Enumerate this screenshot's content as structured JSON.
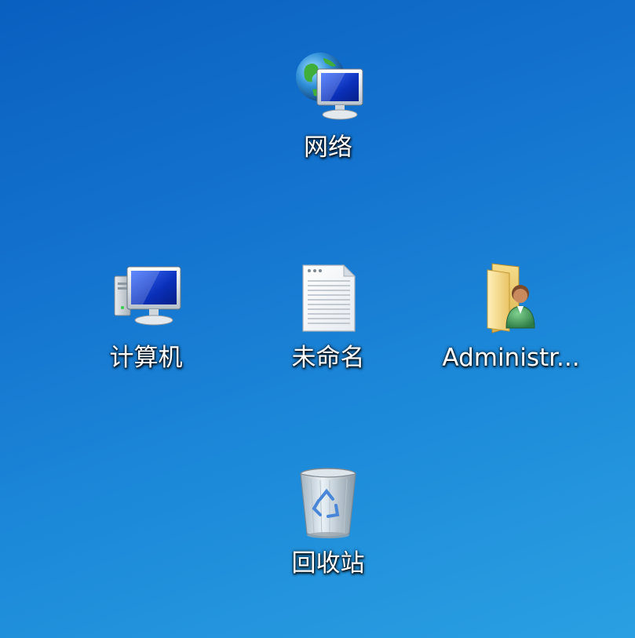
{
  "desktop": {
    "icons": [
      {
        "label": "网络",
        "icon": "network-icon"
      },
      {
        "label": "计算机",
        "icon": "computer-icon"
      },
      {
        "label": "未命名",
        "icon": "text-file-icon"
      },
      {
        "label": "Administr...",
        "icon": "user-folder-icon"
      },
      {
        "label": "回收站",
        "icon": "recycle-bin-icon"
      }
    ]
  },
  "colors": {
    "background_top": "#0a5fbf",
    "background_bottom": "#2aa0e2",
    "label_text": "#ffffff"
  }
}
